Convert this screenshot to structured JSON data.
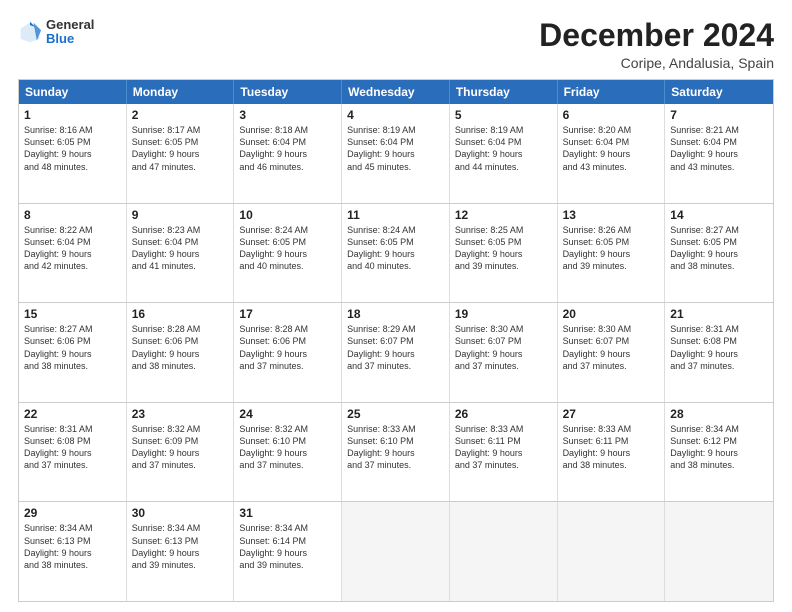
{
  "logo": {
    "general": "General",
    "blue": "Blue"
  },
  "title": "December 2024",
  "subtitle": "Coripe, Andalusia, Spain",
  "header_days": [
    "Sunday",
    "Monday",
    "Tuesday",
    "Wednesday",
    "Thursday",
    "Friday",
    "Saturday"
  ],
  "weeks": [
    [
      {
        "day": "1",
        "info": "Sunrise: 8:16 AM\nSunset: 6:05 PM\nDaylight: 9 hours\nand 48 minutes."
      },
      {
        "day": "2",
        "info": "Sunrise: 8:17 AM\nSunset: 6:05 PM\nDaylight: 9 hours\nand 47 minutes."
      },
      {
        "day": "3",
        "info": "Sunrise: 8:18 AM\nSunset: 6:04 PM\nDaylight: 9 hours\nand 46 minutes."
      },
      {
        "day": "4",
        "info": "Sunrise: 8:19 AM\nSunset: 6:04 PM\nDaylight: 9 hours\nand 45 minutes."
      },
      {
        "day": "5",
        "info": "Sunrise: 8:19 AM\nSunset: 6:04 PM\nDaylight: 9 hours\nand 44 minutes."
      },
      {
        "day": "6",
        "info": "Sunrise: 8:20 AM\nSunset: 6:04 PM\nDaylight: 9 hours\nand 43 minutes."
      },
      {
        "day": "7",
        "info": "Sunrise: 8:21 AM\nSunset: 6:04 PM\nDaylight: 9 hours\nand 43 minutes."
      }
    ],
    [
      {
        "day": "8",
        "info": "Sunrise: 8:22 AM\nSunset: 6:04 PM\nDaylight: 9 hours\nand 42 minutes."
      },
      {
        "day": "9",
        "info": "Sunrise: 8:23 AM\nSunset: 6:04 PM\nDaylight: 9 hours\nand 41 minutes."
      },
      {
        "day": "10",
        "info": "Sunrise: 8:24 AM\nSunset: 6:05 PM\nDaylight: 9 hours\nand 40 minutes."
      },
      {
        "day": "11",
        "info": "Sunrise: 8:24 AM\nSunset: 6:05 PM\nDaylight: 9 hours\nand 40 minutes."
      },
      {
        "day": "12",
        "info": "Sunrise: 8:25 AM\nSunset: 6:05 PM\nDaylight: 9 hours\nand 39 minutes."
      },
      {
        "day": "13",
        "info": "Sunrise: 8:26 AM\nSunset: 6:05 PM\nDaylight: 9 hours\nand 39 minutes."
      },
      {
        "day": "14",
        "info": "Sunrise: 8:27 AM\nSunset: 6:05 PM\nDaylight: 9 hours\nand 38 minutes."
      }
    ],
    [
      {
        "day": "15",
        "info": "Sunrise: 8:27 AM\nSunset: 6:06 PM\nDaylight: 9 hours\nand 38 minutes."
      },
      {
        "day": "16",
        "info": "Sunrise: 8:28 AM\nSunset: 6:06 PM\nDaylight: 9 hours\nand 38 minutes."
      },
      {
        "day": "17",
        "info": "Sunrise: 8:28 AM\nSunset: 6:06 PM\nDaylight: 9 hours\nand 37 minutes."
      },
      {
        "day": "18",
        "info": "Sunrise: 8:29 AM\nSunset: 6:07 PM\nDaylight: 9 hours\nand 37 minutes."
      },
      {
        "day": "19",
        "info": "Sunrise: 8:30 AM\nSunset: 6:07 PM\nDaylight: 9 hours\nand 37 minutes."
      },
      {
        "day": "20",
        "info": "Sunrise: 8:30 AM\nSunset: 6:07 PM\nDaylight: 9 hours\nand 37 minutes."
      },
      {
        "day": "21",
        "info": "Sunrise: 8:31 AM\nSunset: 6:08 PM\nDaylight: 9 hours\nand 37 minutes."
      }
    ],
    [
      {
        "day": "22",
        "info": "Sunrise: 8:31 AM\nSunset: 6:08 PM\nDaylight: 9 hours\nand 37 minutes."
      },
      {
        "day": "23",
        "info": "Sunrise: 8:32 AM\nSunset: 6:09 PM\nDaylight: 9 hours\nand 37 minutes."
      },
      {
        "day": "24",
        "info": "Sunrise: 8:32 AM\nSunset: 6:10 PM\nDaylight: 9 hours\nand 37 minutes."
      },
      {
        "day": "25",
        "info": "Sunrise: 8:33 AM\nSunset: 6:10 PM\nDaylight: 9 hours\nand 37 minutes."
      },
      {
        "day": "26",
        "info": "Sunrise: 8:33 AM\nSunset: 6:11 PM\nDaylight: 9 hours\nand 37 minutes."
      },
      {
        "day": "27",
        "info": "Sunrise: 8:33 AM\nSunset: 6:11 PM\nDaylight: 9 hours\nand 38 minutes."
      },
      {
        "day": "28",
        "info": "Sunrise: 8:34 AM\nSunset: 6:12 PM\nDaylight: 9 hours\nand 38 minutes."
      }
    ],
    [
      {
        "day": "29",
        "info": "Sunrise: 8:34 AM\nSunset: 6:13 PM\nDaylight: 9 hours\nand 38 minutes."
      },
      {
        "day": "30",
        "info": "Sunrise: 8:34 AM\nSunset: 6:13 PM\nDaylight: 9 hours\nand 39 minutes."
      },
      {
        "day": "31",
        "info": "Sunrise: 8:34 AM\nSunset: 6:14 PM\nDaylight: 9 hours\nand 39 minutes."
      },
      {
        "day": "",
        "info": ""
      },
      {
        "day": "",
        "info": ""
      },
      {
        "day": "",
        "info": ""
      },
      {
        "day": "",
        "info": ""
      }
    ]
  ]
}
